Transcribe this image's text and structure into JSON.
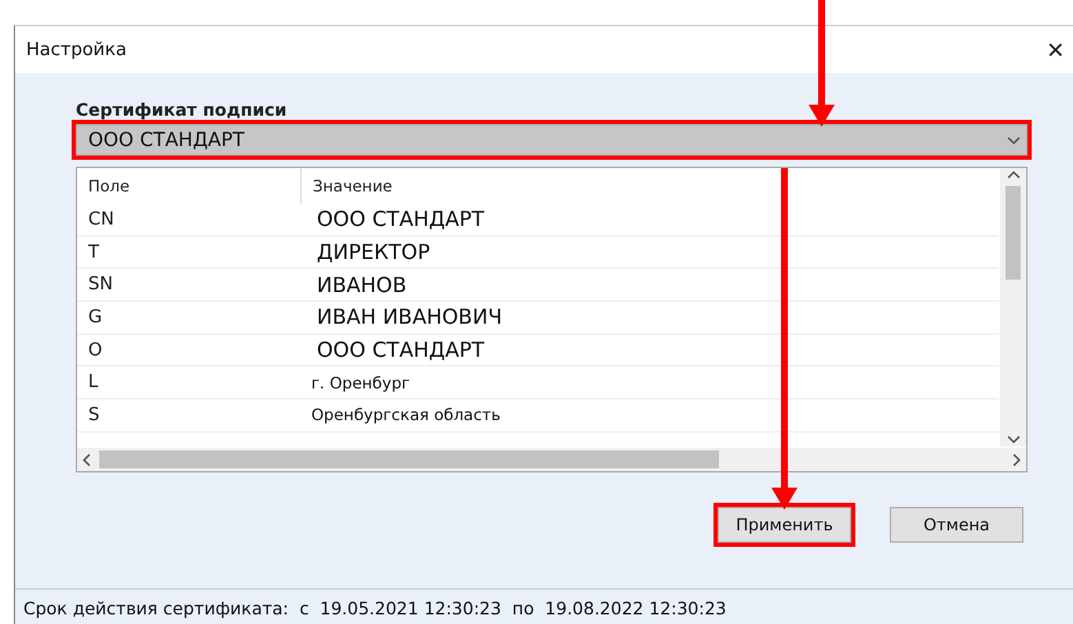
{
  "window": {
    "title": "Настройка",
    "close": "✕"
  },
  "certificate": {
    "label": "Сертификат подписи",
    "value": "ООО СТАНДАРТ",
    "highlighted": true
  },
  "table": {
    "columns": [
      "Поле",
      "Значение"
    ],
    "rows": [
      {
        "field": "CN",
        "value": "ООО СТАНДАРТ",
        "kind": "pasted"
      },
      {
        "field": "T",
        "value": "ДИРЕКТОР",
        "kind": "pasted"
      },
      {
        "field": "SN",
        "value": "ИВАНОВ",
        "kind": "pasted"
      },
      {
        "field": "G",
        "value": "ИВАН ИВАНОВИЧ",
        "kind": "pasted"
      },
      {
        "field": "O",
        "value": "ООО СТАНДАРТ",
        "kind": "pasted"
      },
      {
        "field": "L",
        "value": "г. Оренбург",
        "kind": "plain"
      },
      {
        "field": "S",
        "value": "Оренбургская область",
        "kind": "plain"
      }
    ]
  },
  "buttons": [
    {
      "label": "Применить",
      "highlighted": true
    },
    {
      "label": "Отмена",
      "highlighted": false
    }
  ],
  "status_bar": "Срок действия сертификата:  с  19.05.2021 12:30:23  по  19.08.2022 12:30:23"
}
